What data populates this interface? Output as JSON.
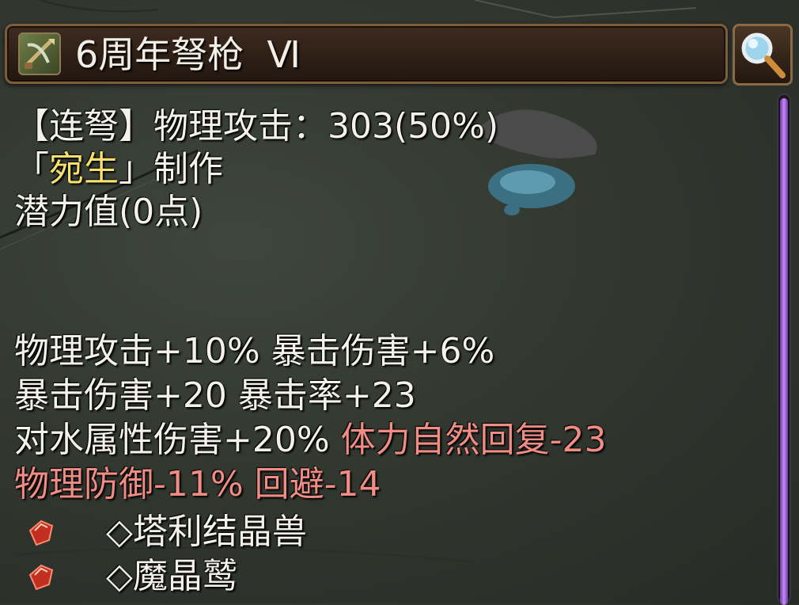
{
  "title": "6周年弩枪  Ⅵ",
  "icons": {
    "weapon": "crossbow-icon",
    "search": "magnifier-icon",
    "gem": "red-crystal-icon"
  },
  "colors": {
    "text": "#f4f1ea",
    "highlight": "#f6e06e",
    "negative": "#f08c83",
    "scroll": "#c58af2"
  },
  "lines": {
    "l1": "【连弩】物理攻击：303(50%)",
    "l2_open": "「",
    "l2_name": "宛生",
    "l2_close": "」制作",
    "l3": "潜力值(0点)",
    "s1": "物理攻击+10% 暴击伤害+6%",
    "s2": "暴击伤害+20 暴击率+23",
    "s3a": "对水属性伤害+20% ",
    "s3b": "体力自然回复-23",
    "s4": "物理防御-11% 回避-14",
    "c1": "◇塔利结晶兽",
    "c2": "◇魔晶鹫"
  }
}
